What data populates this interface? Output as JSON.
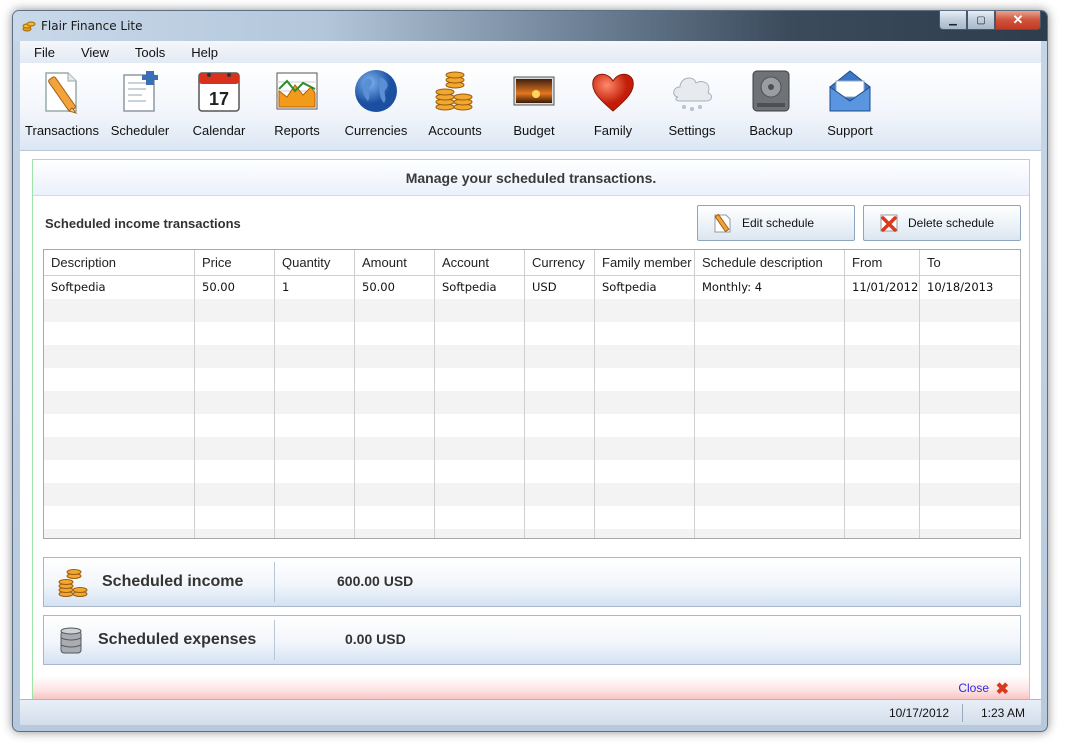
{
  "window": {
    "title": "Flair Finance Lite"
  },
  "menu": {
    "items": [
      "File",
      "View",
      "Tools",
      "Help"
    ]
  },
  "toolbar": {
    "items": [
      {
        "label": "Transactions",
        "icon": "pencil-paper-icon"
      },
      {
        "label": "Scheduler",
        "icon": "scheduler-icon"
      },
      {
        "label": "Calendar",
        "icon": "calendar-icon",
        "day": "17"
      },
      {
        "label": "Reports",
        "icon": "chart-icon"
      },
      {
        "label": "Currencies",
        "icon": "globe-icon"
      },
      {
        "label": "Accounts",
        "icon": "coins-icon"
      },
      {
        "label": "Budget",
        "icon": "picture-icon"
      },
      {
        "label": "Family",
        "icon": "heart-icon"
      },
      {
        "label": "Settings",
        "icon": "cloud-icon"
      },
      {
        "label": "Backup",
        "icon": "hard-drive-icon"
      },
      {
        "label": "Support",
        "icon": "envelope-icon"
      }
    ]
  },
  "page": {
    "heading": "Manage your scheduled transactions.",
    "section_label": "Scheduled income transactions",
    "edit_label": "Edit schedule",
    "delete_label": "Delete schedule"
  },
  "table": {
    "columns": [
      "Description",
      "Price",
      "Quantity",
      "Amount",
      "Account",
      "Currency",
      "Family member",
      "Schedule description",
      "From",
      "To"
    ],
    "rows": [
      [
        "Softpedia",
        "50.00",
        "1",
        "50.00",
        "Softpedia",
        "USD",
        "Softpedia",
        "Monthly: 4",
        "11/01/2012",
        "10/18/2013"
      ]
    ]
  },
  "summary": {
    "income_label": "Scheduled income",
    "income_value": "600.00 USD",
    "expenses_label": "Scheduled expenses",
    "expenses_value": "0.00 USD"
  },
  "footer": {
    "close_label": "Close"
  },
  "status": {
    "date": "10/17/2012",
    "time": "1:23 AM"
  },
  "colors": {
    "accent": "#2d2ddb",
    "close_red": "#d9391c",
    "green_border": "#9fe3a8"
  }
}
